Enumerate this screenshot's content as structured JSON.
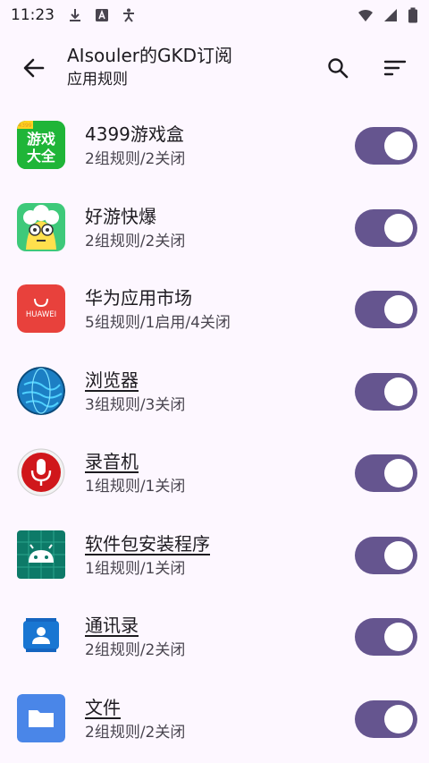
{
  "status_bar": {
    "time": "11:23",
    "icons_left": [
      "download-icon",
      "font-a-icon",
      "accessibility-icon"
    ],
    "icons_right": [
      "wifi-icon",
      "signal-icon",
      "battery-icon"
    ]
  },
  "app_bar": {
    "title": "AIsouler的GKD订阅",
    "subtitle": "应用规则",
    "icons": [
      "back-arrow-icon",
      "search-icon",
      "sort-icon"
    ]
  },
  "apps": [
    {
      "name": "4399游戏盒",
      "desc": "2组规则/2关闭",
      "enabled": true,
      "icon": "4399-game-box-icon",
      "underlined": false
    },
    {
      "name": "好游快爆",
      "desc": "2组规则/2关闭",
      "enabled": true,
      "icon": "haoyou-kuaibao-icon",
      "underlined": false
    },
    {
      "name": "华为应用市场",
      "desc": "5组规则/1启用/4关闭",
      "enabled": true,
      "icon": "huawei-appgallery-icon",
      "underlined": false
    },
    {
      "name": "浏览器",
      "desc": "3组规则/3关闭",
      "enabled": true,
      "icon": "browser-globe-icon",
      "underlined": true
    },
    {
      "name": "录音机",
      "desc": "1组规则/1关闭",
      "enabled": true,
      "icon": "recorder-mic-icon",
      "underlined": true
    },
    {
      "name": "软件包安装程序",
      "desc": "1组规则/1关闭",
      "enabled": true,
      "icon": "package-installer-icon",
      "underlined": true
    },
    {
      "name": "通讯录",
      "desc": "2组规则/2关闭",
      "enabled": true,
      "icon": "contacts-icon",
      "underlined": true
    },
    {
      "name": "文件",
      "desc": "2组规则/2关闭",
      "enabled": true,
      "icon": "files-folder-icon",
      "underlined": true
    }
  ],
  "icon_texts": {
    "game_box_line1": "游戏",
    "game_box_line2": "大全",
    "game_box_badge": "4399",
    "huawei": "HUAWEI"
  },
  "colors": {
    "switch_track": "#65558f",
    "background": "#fdf7ff"
  }
}
